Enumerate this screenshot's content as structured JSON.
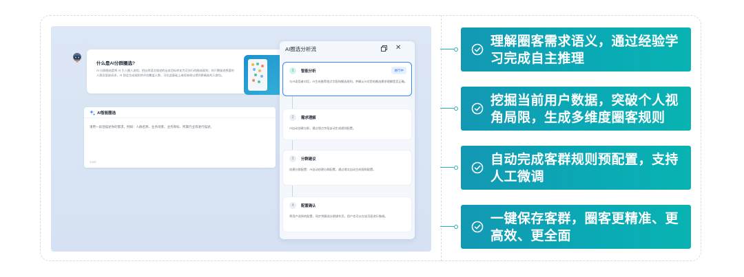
{
  "intro": {
    "title": "什么是AI分群圈选?",
    "body": "AI 分群圈选是将 AI 引入圈人流程，把自然语言描述的业务目标转化为可执行的圈选规则；你只需描述想要的人群及投放诉求，AI 即会生成规则并评估覆盖人数，可在此基础上继续修改以得到更精准的人群包。"
  },
  "ai_card": {
    "title": "AI智能圈选",
    "placeholder": "请用一段话描述你的需求，例如：人群名称、业务场景、业务目标、所属行业等进行描述。",
    "count": "0/100"
  },
  "panel": {
    "title": "AI圈选分析流",
    "steps": [
      {
        "num": "1",
        "title": "智能分析",
        "badge": "进行中",
        "desc": "与AI语音者对话，AI生成推荐埋点字段和圈选规则，并确认AI对您的圈选需求理解是否正确。"
      },
      {
        "num": "2",
        "title": "需求理解",
        "desc": "AI自动创建分群，通过埋点字段自动生成规则配置。"
      },
      {
        "num": "3",
        "title": "分群建议",
        "desc": "创建分群配置：AI自动创建分群配置，通过埋点自动生成规则配置。"
      },
      {
        "num": "4",
        "title": "配置确认",
        "desc": "将用户选择的配置，同步到圈选分群操作页，用户也可以在该页面进行微调。"
      }
    ]
  },
  "features": [
    {
      "text": "理解圈客需求语义，通过经验学习完成自主推理"
    },
    {
      "text": "挖掘当前用户数据，突破个人视角局限，生成多维度圈客规则"
    },
    {
      "text": "自动完成客群规则预配置，支持人工微调"
    },
    {
      "text": "一键保存客群，圈客更精准、更高效、更全面"
    }
  ],
  "colors": {
    "feature_bg": "#0aa9b5",
    "active_border": "#2e86ff",
    "badge_text": "#2e6fff"
  }
}
